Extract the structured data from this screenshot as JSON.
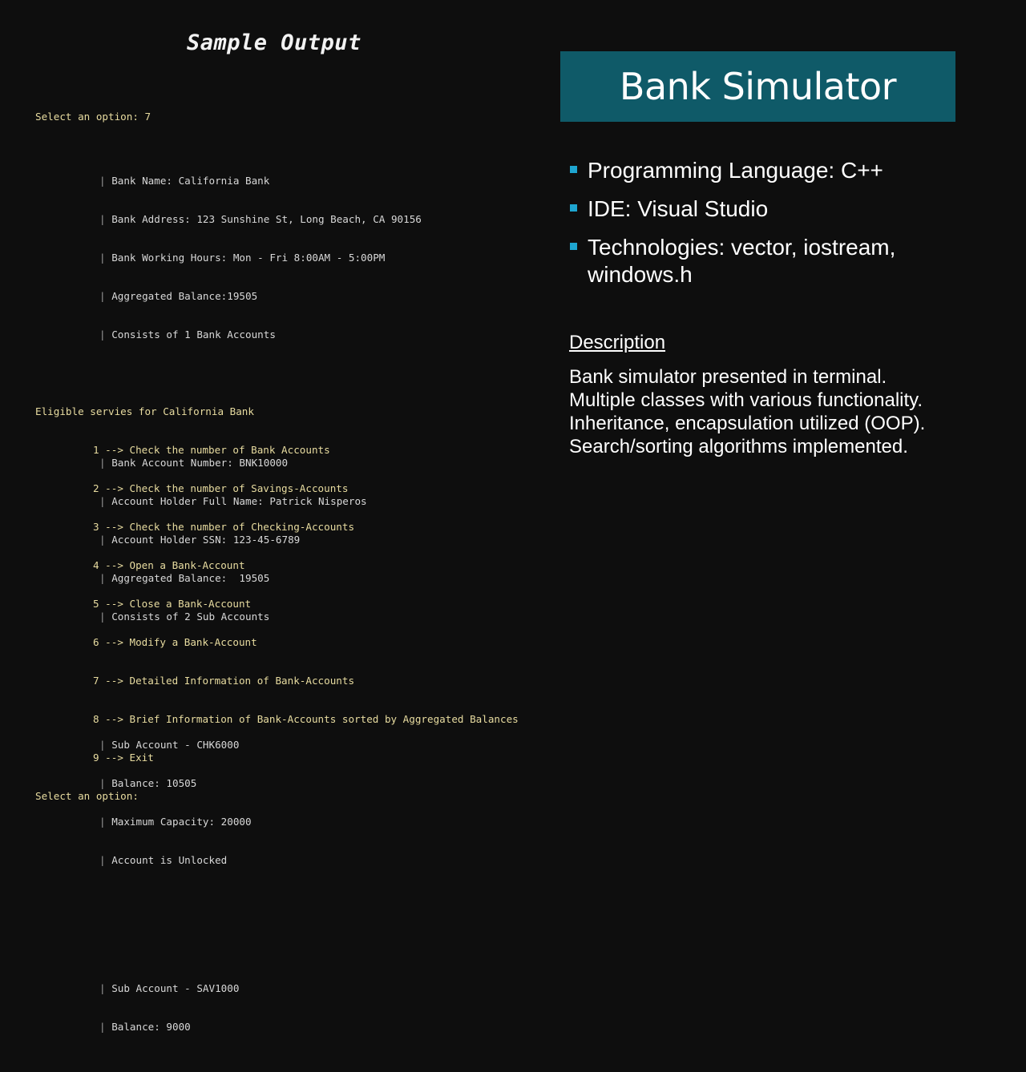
{
  "sample_title": "Sample Output",
  "terminal": {
    "prompt_first": "Select an option: 7",
    "bank_details": [
      "Bank Name: California Bank",
      "Bank Address: 123 Sunshine St, Long Beach, CA 90156",
      "Bank Working Hours: Mon - Fri 8:00AM - 5:00PM",
      "Aggregated Balance:19505",
      "Consists of 1 Bank Accounts"
    ],
    "account_details": [
      "Bank Account Number: BNK10000",
      "Account Holder Full Name: Patrick Nisperos",
      "Account Holder SSN: 123-45-6789",
      "Aggregated Balance:  19505",
      "Consists of 2 Sub Accounts"
    ],
    "sub_account_1": [
      "Sub Account - CHK6000",
      "Balance: 10505",
      "Maximum Capacity: 20000",
      "Account is Unlocked"
    ],
    "sub_account_2": [
      "Sub Account - SAV1000",
      "Balance: 9000"
    ],
    "pipe": "|",
    "menu_header": "Eligible servies for California Bank",
    "menu_items": [
      "1 --> Check the number of Bank Accounts",
      "2 --> Check the number of Savings-Accounts",
      "3 --> Check the number of Checking-Accounts",
      "4 --> Open a Bank-Account",
      "5 --> Close a Bank-Account",
      "6 --> Modify a Bank-Account",
      "7 --> Detailed Information of Bank-Accounts",
      "8 --> Brief Information of Bank-Accounts sorted by Aggregated Balances",
      "9 --> Exit"
    ],
    "prompt_last": "Select an option:"
  },
  "slide": {
    "title": "Bank Simulator",
    "title_bg": "#0f5a68",
    "bullet_color": "#1ea5d0",
    "bullets": [
      "Programming Language: C++",
      "IDE: Visual Studio",
      "Technologies: vector, iostream, windows.h"
    ],
    "description_heading": "Description",
    "description_lines": [
      "Bank simulator presented in terminal.",
      "Multiple classes with various functionality.",
      "Inheritance, encapsulation utilized (OOP).",
      "Search/sorting algorithms implemented."
    ]
  }
}
